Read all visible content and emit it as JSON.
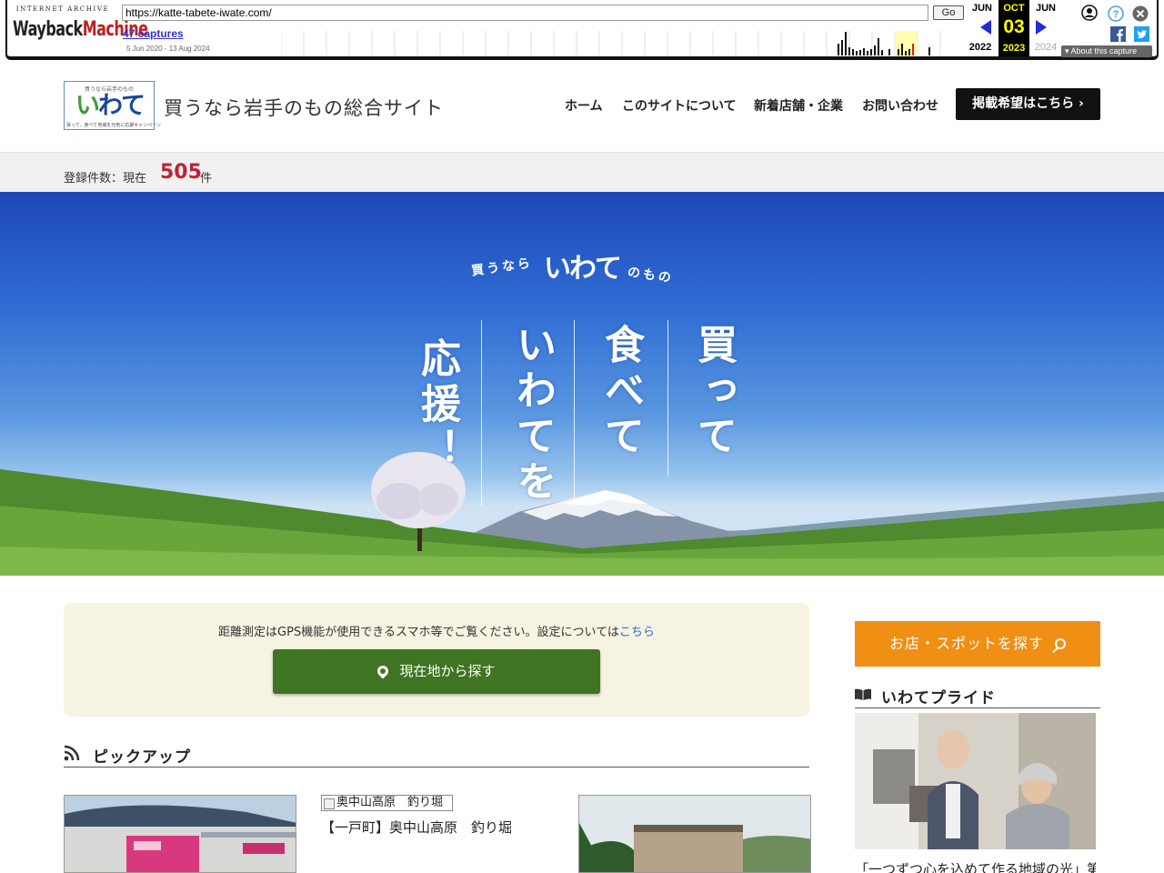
{
  "wayback": {
    "logo_top": "INTERNET ARCHIVE",
    "logo_main_a": "Wayback",
    "logo_main_b": "Machine",
    "url": "https://katte-tabete-iwate.com/",
    "go_label": "Go",
    "captures_label": "47 captures",
    "date_range": "5 Jun 2020 - 13 Aug 2024",
    "prev_month": "JUN",
    "prev_year": "2022",
    "current_month": "OCT",
    "current_day": "03",
    "current_year": "2023",
    "next_month": "JUN",
    "next_year": "2024",
    "about_label": "About this capture",
    "colors": {
      "link": "#3333cc",
      "current": "#ffff00",
      "arrow": "#1e2dd4"
    }
  },
  "header": {
    "logo": {
      "tagline": "買うなら岩手のもの",
      "wordmark_a": "い",
      "wordmark_b": "わて",
      "footer": "買って、食べて地域を元気に応援キャンペーン"
    },
    "site_title": "買うなら岩手のもの総合サイト",
    "nav": [
      "ホーム",
      "このサイトについて",
      "新着店舗・企業",
      "お問い合わせ"
    ],
    "cta_label": "掲載希望はこちら ›"
  },
  "count_bar": {
    "label": "登録件数：現在",
    "count": "505",
    "unit": "件"
  },
  "hero": {
    "sub_left": "買うなら",
    "logo": "いわて",
    "sub_right": "のもの",
    "col1": "買って",
    "col2": "食べて",
    "col3": "いわてを",
    "col4": "応援！"
  },
  "gps": {
    "note": "距離測定はGPS機能が使用できるスマホ等でご覧ください。設定については",
    "note_link": "こちら",
    "button_label": "現在地から探す",
    "button_color": "#3f7422"
  },
  "pickup": {
    "heading": "ピックアップ",
    "cards": [
      {
        "alt": "",
        "title": ""
      },
      {
        "alt": "奥中山高原　釣り堀",
        "title": "【一戸町】奥中山高原　釣り堀"
      },
      {
        "alt": "",
        "title": ""
      }
    ]
  },
  "sidebar": {
    "search_label": "お店・スポットを探す",
    "search_color": "#ef8f14",
    "pride_heading": "いわてプライド",
    "pride_caption": "「一つずつ心を込めて作る地域の光」第"
  }
}
